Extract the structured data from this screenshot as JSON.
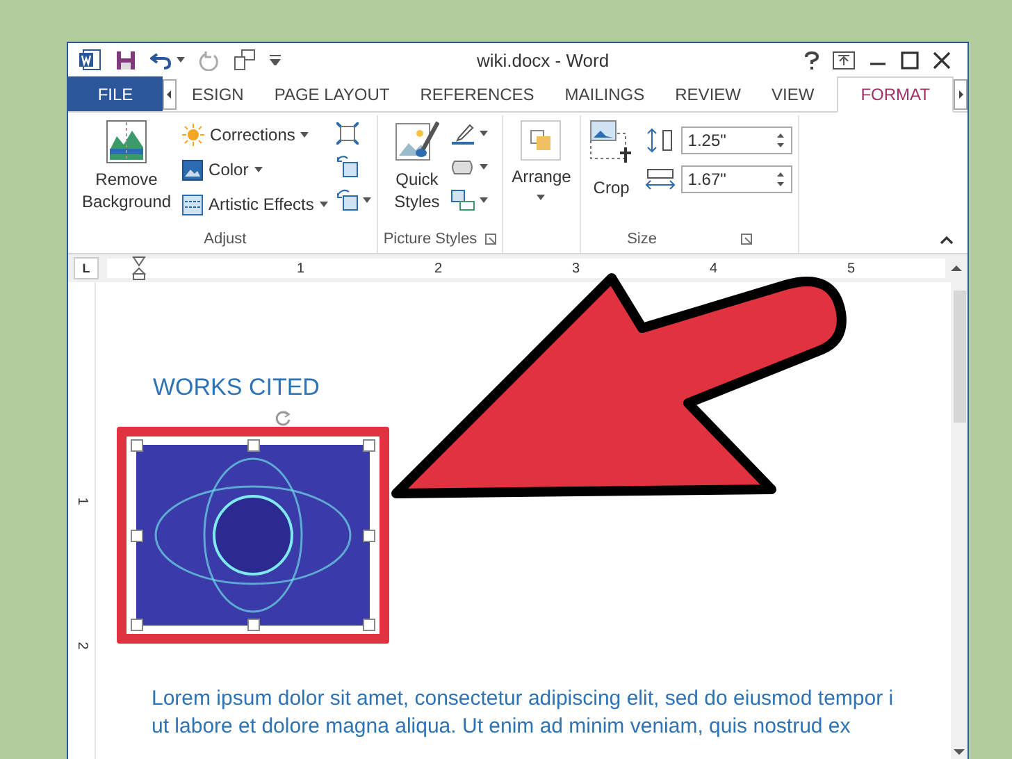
{
  "window": {
    "title": "wiki.docx - Word"
  },
  "tabs": [
    {
      "label": "FILE",
      "kind": "file",
      "selected": false
    },
    {
      "label": "ESIGN",
      "kind": "tab",
      "selected": false
    },
    {
      "label": "PAGE LAYOUT",
      "kind": "tab",
      "selected": false
    },
    {
      "label": "REFERENCES",
      "kind": "tab",
      "selected": false
    },
    {
      "label": "MAILINGS",
      "kind": "tab",
      "selected": false
    },
    {
      "label": "REVIEW",
      "kind": "tab",
      "selected": false
    },
    {
      "label": "VIEW",
      "kind": "tab",
      "selected": false
    },
    {
      "label": "FORMAT",
      "kind": "tab",
      "selected": true
    }
  ],
  "ribbon": {
    "adjust": {
      "label": "Adjust",
      "remove_background": [
        "Remove",
        "Background"
      ],
      "commands": [
        "Corrections",
        "Color",
        "Artistic Effects"
      ]
    },
    "picture_styles": {
      "label": "Picture Styles",
      "quick_styles": [
        "Quick",
        "Styles"
      ]
    },
    "arrange": {
      "label": "Arrange"
    },
    "size": {
      "label": "Size",
      "crop": "Crop",
      "height": "1.25\"",
      "width": "1.67\""
    }
  },
  "ruler": {
    "tab_selector": "L",
    "numbers": [
      "1",
      "2",
      "3",
      "4",
      "5"
    ],
    "vertical_numbers": [
      "1",
      "2"
    ]
  },
  "document": {
    "heading": "WORKS CITED",
    "lines": [
      "Lorem ipsum dolor sit amet, consectetur adipiscing elit, sed do eiusmod tempor i",
      "ut labore et dolore magna aliqua. Ut enim ad minim veniam, quis nostrud ex"
    ]
  }
}
